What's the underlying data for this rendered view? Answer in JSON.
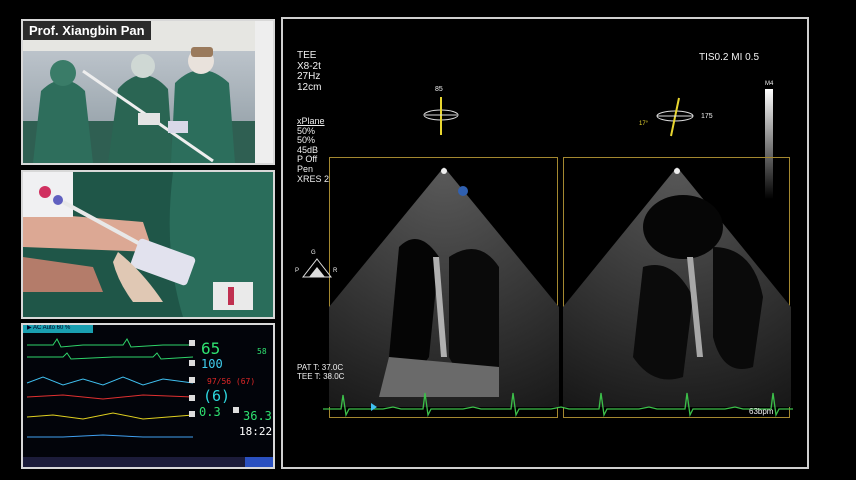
{
  "camera_top": {
    "label": "Prof. Xiangbin Pan"
  },
  "monitor": {
    "top_tab": "▶ AC Auto 60 %",
    "hr": "65",
    "hr_side": "58",
    "spo2": "100",
    "bp": "97/56 (67)",
    "cvp": "(6)",
    "temp_small": "0.3",
    "temp": "36.3",
    "time": "18:22"
  },
  "echo": {
    "header_lines": [
      "TEE",
      "X8-2t",
      "27Hz",
      "12cm"
    ],
    "params_title": "xPlane",
    "params": [
      "50%",
      "50%",
      "45dB",
      "P Off",
      "Pen",
      "XRES 2"
    ],
    "tis_mi": "TIS0.2  MI 0.5",
    "angle_left": "85",
    "angle_right": "175",
    "angle_right_small": "17°",
    "scale_label": "M4",
    "orient_g": "G",
    "orient_p": "P",
    "orient_r": "R",
    "pat_temp": "PAT T: 37.0C",
    "tee_temp": "TEE T: 38.0C",
    "bpm": "63bpm"
  }
}
